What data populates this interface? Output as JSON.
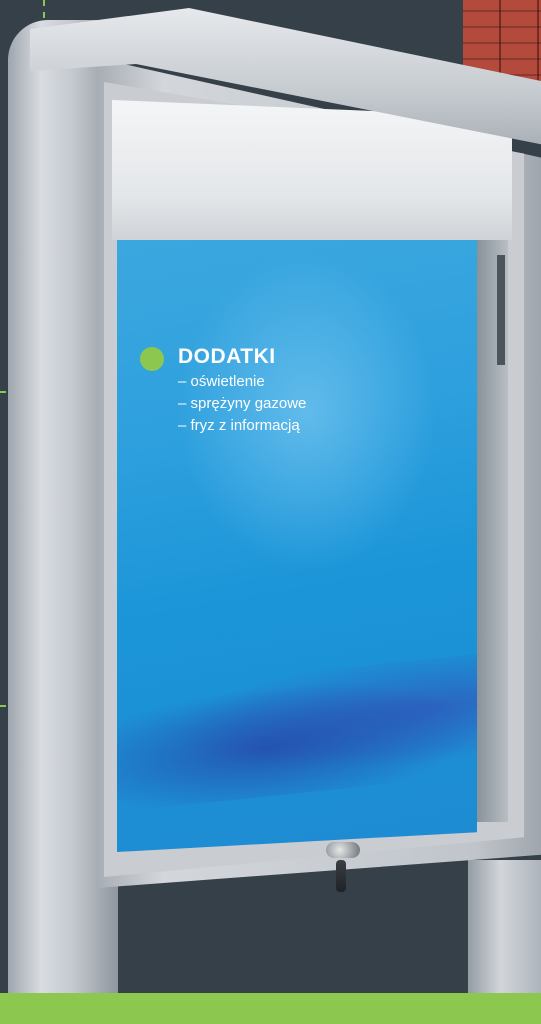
{
  "colors": {
    "background": "#364049",
    "accent_green": "#8cc850",
    "poster_blue": "#2ea0de"
  },
  "info": {
    "bullet_icon": "green-dot",
    "title": "DODATKI",
    "items": [
      "– oświetlenie",
      "– sprężyny gazowe",
      "– fryz z informacją"
    ]
  }
}
